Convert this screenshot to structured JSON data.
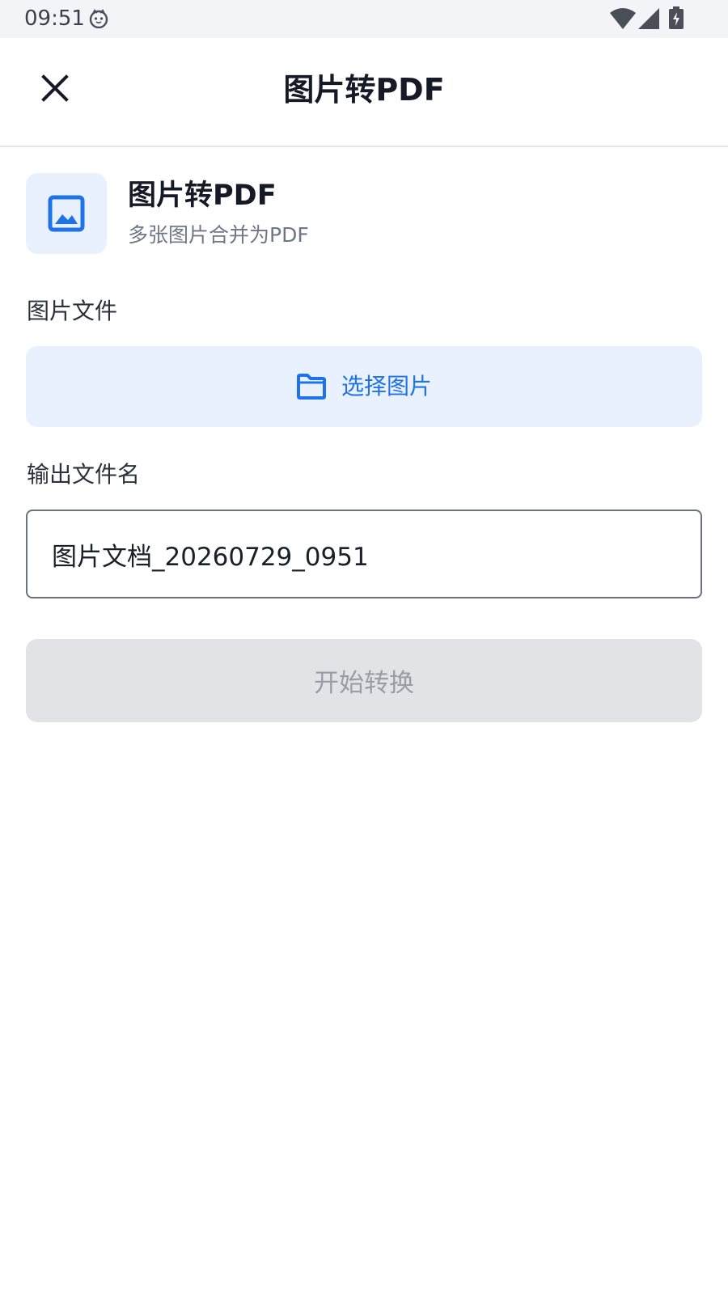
{
  "status_bar": {
    "time": "09:51",
    "icons": [
      "cat-face-icon",
      "wifi-icon",
      "cell-signal-icon",
      "battery-charging-icon"
    ]
  },
  "app_bar": {
    "close_icon": "close-icon",
    "title": "图片转PDF"
  },
  "header": {
    "icon": "image-icon",
    "title": "图片转PDF",
    "subtitle": "多张图片合并为PDF"
  },
  "image_section": {
    "label": "图片文件",
    "select_icon": "folder-icon",
    "select_label": "选择图片"
  },
  "output_section": {
    "label": "输出文件名",
    "filename_value": "图片文档_20260729_0951"
  },
  "convert_button": {
    "label": "开始转换",
    "enabled": false
  },
  "colors": {
    "accent": "#1f73e8",
    "accent_bg": "#e9f1fe",
    "disabled_bg": "#e2e3e6",
    "disabled_text": "#9a9da4"
  }
}
